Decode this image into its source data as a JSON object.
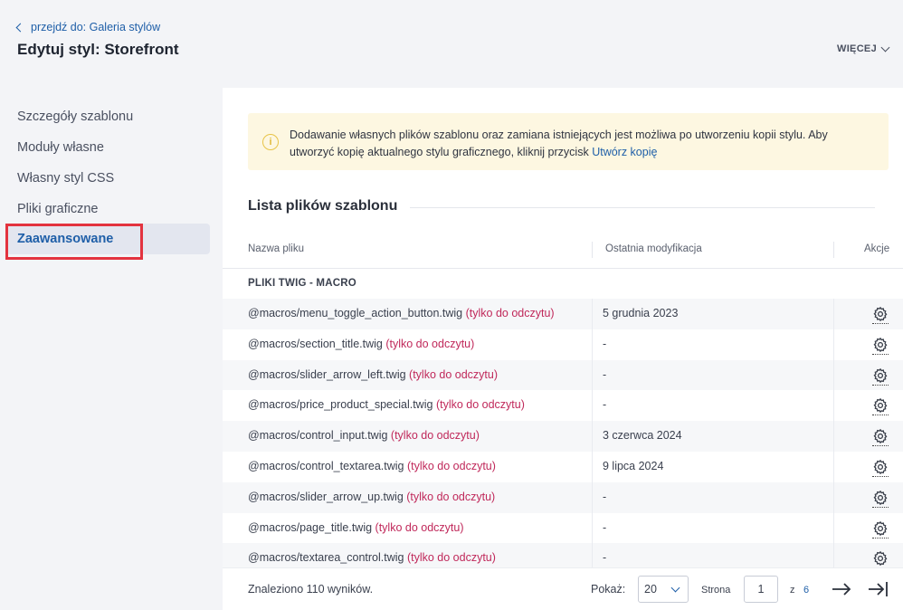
{
  "header": {
    "breadcrumb": "przejdź do: Galeria stylów",
    "title": "Edytuj styl: Storefront",
    "more_label": "WIĘCEJ"
  },
  "sidebar": {
    "items": [
      {
        "label": "Szczegóły szablonu"
      },
      {
        "label": "Moduły własne"
      },
      {
        "label": "Własny styl CSS"
      },
      {
        "label": "Pliki graficzne"
      },
      {
        "label": "Zaawansowane"
      }
    ],
    "active_index": 4
  },
  "notice": {
    "text": "Dodawanie własnych plików szablonu oraz zamiana istniejących jest możliwa po utworzeniu kopii stylu. Aby utworzyć kopię aktualnego stylu graficznego, kliknij przycisk",
    "link": "Utwórz kopię",
    "icon": "info-icon"
  },
  "section": {
    "title": "Lista plików szablonu"
  },
  "table": {
    "columns": [
      "Nazwa pliku",
      "Ostatnia modyfikacja",
      "Akcje"
    ],
    "group_label": "PLIKI TWIG - MACRO",
    "read_only_label": "(tylko do odczytu)",
    "rows": [
      {
        "name": "@macros/menu_toggle_action_button.twig",
        "modified": "5 grudnia 2023"
      },
      {
        "name": "@macros/section_title.twig",
        "modified": "-"
      },
      {
        "name": "@macros/slider_arrow_left.twig",
        "modified": "-"
      },
      {
        "name": "@macros/price_product_special.twig",
        "modified": "-"
      },
      {
        "name": "@macros/control_input.twig",
        "modified": "3 czerwca 2024"
      },
      {
        "name": "@macros/control_textarea.twig",
        "modified": "9 lipca 2024"
      },
      {
        "name": "@macros/slider_arrow_up.twig",
        "modified": "-"
      },
      {
        "name": "@macros/page_title.twig",
        "modified": "-"
      },
      {
        "name": "@macros/textarea_control.twig",
        "modified": "-"
      }
    ]
  },
  "footer": {
    "found": "Znaleziono 110 wyników.",
    "show_label": "Pokaż:",
    "per_page": "20",
    "page_label": "Strona",
    "current_page": "1",
    "of_label": "z",
    "total_pages": "6"
  },
  "colors": {
    "accent": "#1f5fa8",
    "read_only": "#c0285a",
    "highlight_border": "#e3333f",
    "notice_bg": "#fdf7e1"
  }
}
